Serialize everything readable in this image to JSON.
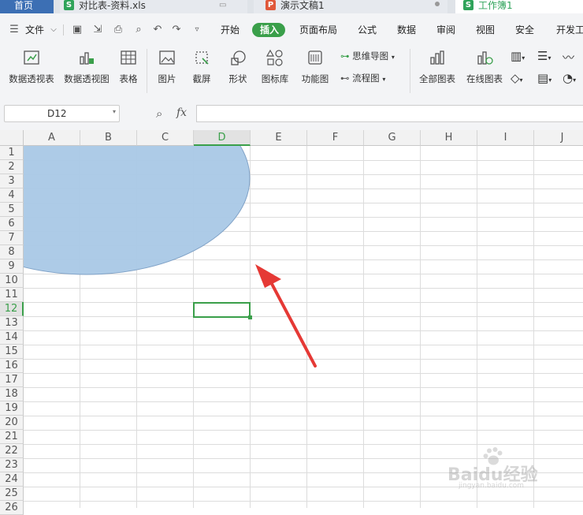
{
  "tabs": [
    {
      "label": "首页",
      "icon": ""
    },
    {
      "label": "对比表-资料.xls",
      "icon": "S"
    },
    {
      "label": "演示文稿1",
      "icon": "P"
    },
    {
      "label": "工作簿1",
      "icon": "S"
    }
  ],
  "menu": {
    "file_label": "文件",
    "items": [
      "开始",
      "插入",
      "页面布局",
      "公式",
      "数据",
      "审阅",
      "视图",
      "安全",
      "开发工"
    ],
    "active_item": "插入"
  },
  "ribbon": {
    "buttons": [
      "数据透视表",
      "数据透视图",
      "表格",
      "图片",
      "截屏",
      "形状",
      "图标库",
      "功能图",
      "思维导图",
      "流程图",
      "全部图表",
      "在线图表"
    ]
  },
  "formula_bar": {
    "name_box": "D12",
    "fx_label": "fx",
    "formula_value": ""
  },
  "sheet": {
    "columns": [
      "A",
      "B",
      "C",
      "D",
      "E",
      "F",
      "G",
      "H",
      "I",
      "J"
    ],
    "rows": [
      "1",
      "2",
      "3",
      "4",
      "5",
      "6",
      "7",
      "8",
      "9",
      "10",
      "11",
      "12",
      "13",
      "14",
      "15",
      "16",
      "17",
      "18",
      "19",
      "20",
      "21",
      "22",
      "23",
      "24",
      "25",
      "26"
    ],
    "selected_cell": "D12",
    "selected_column": "D",
    "selected_row": "12"
  },
  "shape": {
    "type": "ellipse",
    "fill": "#a9c8e6",
    "stroke": "#7fa1c6"
  },
  "annotation": {
    "type": "red-arrow",
    "color": "#e53935"
  },
  "watermark": {
    "text": "Baidu经验",
    "sub": "jingyan.baidu.com"
  },
  "colors": {
    "accent_green": "#3a9f4a",
    "tab_bar": "#dfe3e8",
    "ribbon_bg": "#f3f4f6",
    "ppt_orange": "#e0583a",
    "sheet_green": "#2fa35a"
  }
}
